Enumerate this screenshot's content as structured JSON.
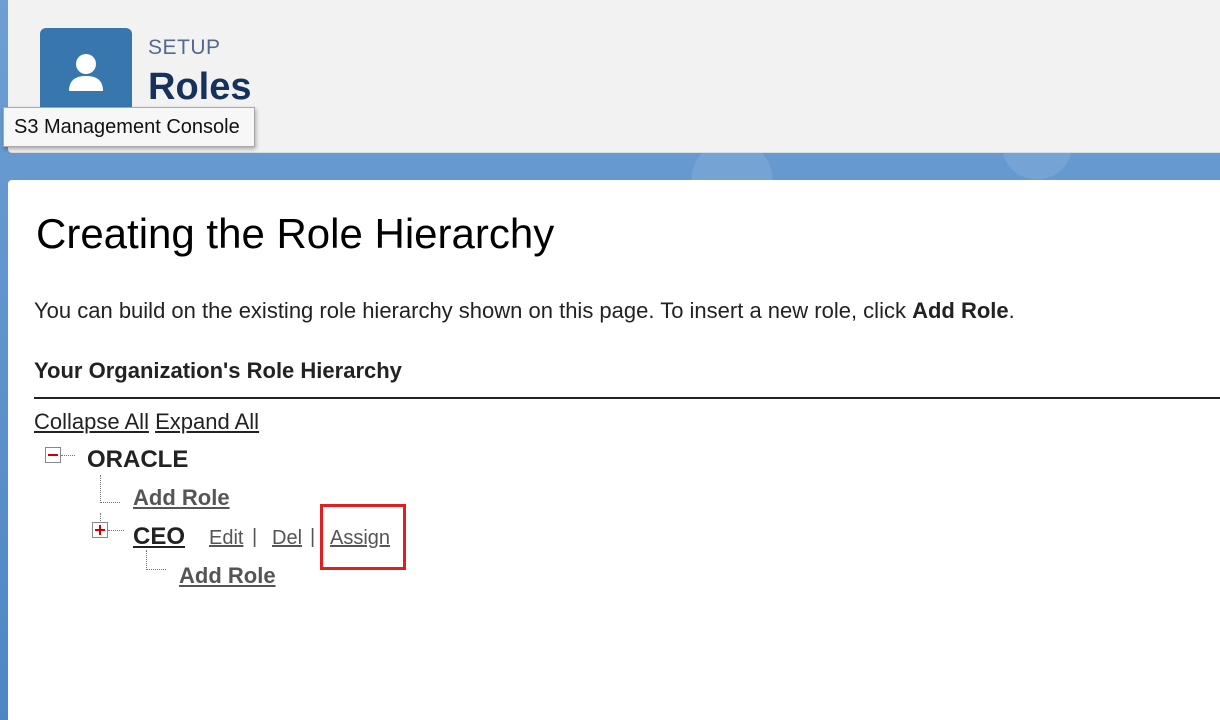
{
  "header": {
    "eyebrow": "SETUP",
    "title": "Roles",
    "icon": "user-icon",
    "icon_color": "#3777ad"
  },
  "tooltip": {
    "text": "S3 Management Console"
  },
  "main": {
    "heading": "Creating the Role Hierarchy",
    "intro_prefix": "You can build on the existing role hierarchy shown on this page. To insert a new role, click ",
    "intro_bold": "Add Role",
    "intro_suffix": ".",
    "section_title": "Your Organization's Role Hierarchy",
    "collapse_all": "Collapse All",
    "expand_all": "Expand All"
  },
  "tree": {
    "root": {
      "label": "ORACLE",
      "toggle": "collapse",
      "add_role": "Add Role"
    },
    "child": {
      "label": "CEO",
      "toggle": "expand",
      "actions": {
        "edit": "Edit",
        "del": "Del",
        "assign": "Assign"
      },
      "separator": "|",
      "add_role": "Add Role"
    }
  },
  "annotation": {
    "highlight_color": "#e02020"
  }
}
